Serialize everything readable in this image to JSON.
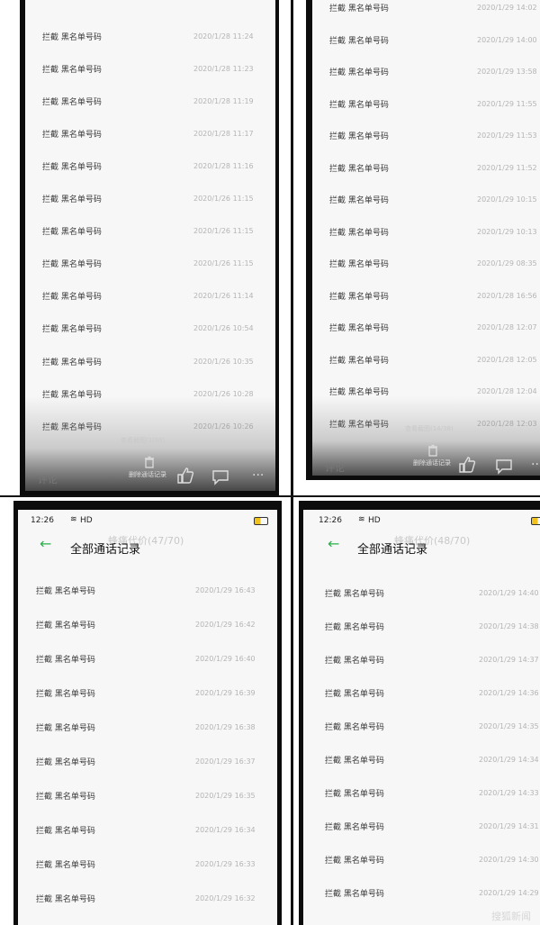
{
  "panels": {
    "top_left": {
      "rows": [
        {
          "label": "拦截 黑名单号码",
          "time": "2020/1/28 11:24"
        },
        {
          "label": "拦截 黑名单号码",
          "time": "2020/1/28 11:23"
        },
        {
          "label": "拦截 黑名单号码",
          "time": "2020/1/28 11:19"
        },
        {
          "label": "拦截 黑名单号码",
          "time": "2020/1/28 11:17"
        },
        {
          "label": "拦截 黑名单号码",
          "time": "2020/1/28 11:16"
        },
        {
          "label": "拦截 黑名单号码",
          "time": "2020/1/26 11:15"
        },
        {
          "label": "拦截 黑名单号码",
          "time": "2020/1/26 11:15"
        },
        {
          "label": "拦截 黑名单号码",
          "time": "2020/1/26 11:15"
        },
        {
          "label": "拦截 黑名单号码",
          "time": "2020/1/26 11:14"
        },
        {
          "label": "拦截 黑名单号码",
          "time": "2020/1/26 10:54"
        },
        {
          "label": "拦截 黑名单号码",
          "time": "2020/1/26 10:35"
        },
        {
          "label": "拦截 黑名单号码",
          "time": "2020/1/26 10:28"
        },
        {
          "label": "拦截 黑名单号码",
          "time": "2020/1/26 10:26"
        }
      ],
      "footer_hint": "查看截图(1/30)",
      "delete_label": "删除通话记录",
      "comment_label": "评论"
    },
    "top_right": {
      "rows": [
        {
          "label": "拦截 黑名单号码",
          "time": "2020/1/29 14:00"
        },
        {
          "label": "拦截 黑名单号码",
          "time": "2020/1/29 13:58"
        },
        {
          "label": "拦截 黑名单号码",
          "time": "2020/1/29 11:55"
        },
        {
          "label": "拦截 黑名单号码",
          "time": "2020/1/29 11:53"
        },
        {
          "label": "拦截 黑名单号码",
          "time": "2020/1/29 11:52"
        },
        {
          "label": "拦截 黑名单号码",
          "time": "2020/1/29 10:15"
        },
        {
          "label": "拦截 黑名单号码",
          "time": "2020/1/29 10:13"
        },
        {
          "label": "拦截 黑名单号码",
          "time": "2020/1/29 08:35"
        },
        {
          "label": "拦截 黑名单号码",
          "time": "2020/1/28 16:56"
        },
        {
          "label": "拦截 黑名单号码",
          "time": "2020/1/28 12:07"
        },
        {
          "label": "拦截 黑名单号码",
          "time": "2020/1/28 12:05"
        },
        {
          "label": "拦截 黑名单号码",
          "time": "2020/1/28 12:04"
        },
        {
          "label": "拦截 黑名单号码",
          "time": "2020/1/28 12:03"
        }
      ],
      "top_partial": {
        "label": "拦截 黑名单号码",
        "time": "2020/1/29 14:02"
      },
      "footer_hint": "查看截图(14/38)",
      "delete_label": "删除通话记录",
      "comment_label": "评论"
    },
    "bottom_left": {
      "status_time": "12:26",
      "status_net": "HD",
      "overlay_title": "蜂痛代价(47/70)",
      "title": "全部通话记录",
      "rows": [
        {
          "label": "拦截 黑名单号码",
          "time": "2020/1/29 16:43"
        },
        {
          "label": "拦截 黑名单号码",
          "time": "2020/1/29 16:42"
        },
        {
          "label": "拦截 黑名单号码",
          "time": "2020/1/29 16:40"
        },
        {
          "label": "拦截 黑名单号码",
          "time": "2020/1/29 16:39"
        },
        {
          "label": "拦截 黑名单号码",
          "time": "2020/1/29 16:38"
        },
        {
          "label": "拦截 黑名单号码",
          "time": "2020/1/29 16:37"
        },
        {
          "label": "拦截 黑名单号码",
          "time": "2020/1/29 16:35"
        },
        {
          "label": "拦截 黑名单号码",
          "time": "2020/1/29 16:34"
        },
        {
          "label": "拦截 黑名单号码",
          "time": "2020/1/29 16:33"
        },
        {
          "label": "拦截 黑名单号码",
          "time": "2020/1/29 16:32"
        }
      ]
    },
    "bottom_right": {
      "status_time": "12:26",
      "status_net": "HD",
      "overlay_title": "蜂痛代价(48/70)",
      "title": "全部通话记录",
      "rows": [
        {
          "label": "拦截 黑名单号码",
          "time": "2020/1/29 14:40"
        },
        {
          "label": "拦截 黑名单号码",
          "time": "2020/1/29 14:38"
        },
        {
          "label": "拦截 黑名单号码",
          "time": "2020/1/29 14:37"
        },
        {
          "label": "拦截 黑名单号码",
          "time": "2020/1/29 14:36"
        },
        {
          "label": "拦截 黑名单号码",
          "time": "2020/1/29 14:35"
        },
        {
          "label": "拦截 黑名单号码",
          "time": "2020/1/29 14:34"
        },
        {
          "label": "拦截 黑名单号码",
          "time": "2020/1/29 14:33"
        },
        {
          "label": "拦截 黑名单号码",
          "time": "2020/1/29 14:31"
        },
        {
          "label": "拦截 黑名单号码",
          "time": "2020/1/29 14:30"
        },
        {
          "label": "拦截 黑名单号码",
          "time": "2020/1/29 14:29"
        }
      ]
    }
  },
  "watermark": "搜狐新闻"
}
